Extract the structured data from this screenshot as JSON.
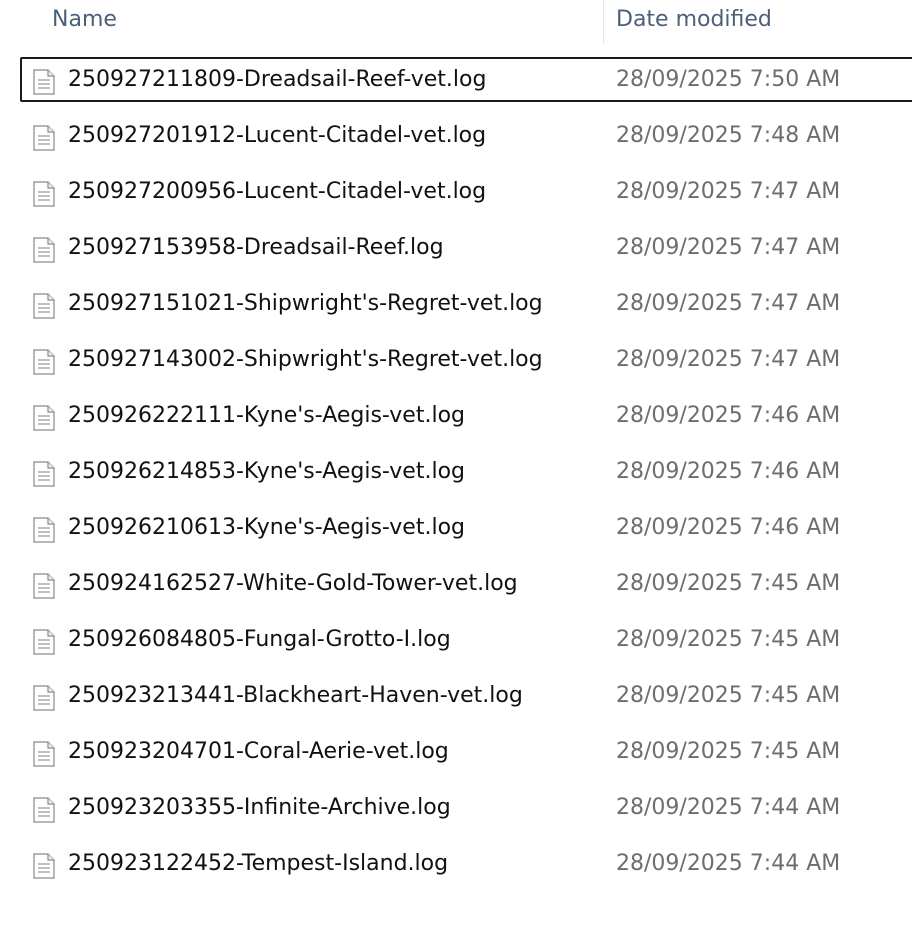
{
  "columns": {
    "name": "Name",
    "date_modified": "Date modified"
  },
  "icons": {
    "file": "text-file-icon",
    "sort": "sort-caret-icon"
  },
  "files": [
    {
      "name": "250927211809-Dreadsail-Reef-vet.log",
      "date": "28/09/2025 7:50 AM",
      "focused": true
    },
    {
      "name": "250927201912-Lucent-Citadel-vet.log",
      "date": "28/09/2025 7:48 AM"
    },
    {
      "name": "250927200956-Lucent-Citadel-vet.log",
      "date": "28/09/2025 7:47 AM"
    },
    {
      "name": "250927153958-Dreadsail-Reef.log",
      "date": "28/09/2025 7:47 AM"
    },
    {
      "name": "250927151021-Shipwright's-Regret-vet.log",
      "date": "28/09/2025 7:47 AM"
    },
    {
      "name": "250927143002-Shipwright's-Regret-vet.log",
      "date": "28/09/2025 7:47 AM"
    },
    {
      "name": "250926222111-Kyne's-Aegis-vet.log",
      "date": "28/09/2025 7:46 AM"
    },
    {
      "name": "250926214853-Kyne's-Aegis-vet.log",
      "date": "28/09/2025 7:46 AM"
    },
    {
      "name": "250926210613-Kyne's-Aegis-vet.log",
      "date": "28/09/2025 7:46 AM"
    },
    {
      "name": "250924162527-White-Gold-Tower-vet.log",
      "date": "28/09/2025 7:45 AM"
    },
    {
      "name": "250926084805-Fungal-Grotto-I.log",
      "date": "28/09/2025 7:45 AM"
    },
    {
      "name": "250923213441-Blackheart-Haven-vet.log",
      "date": "28/09/2025 7:45 AM"
    },
    {
      "name": "250923204701-Coral-Aerie-vet.log",
      "date": "28/09/2025 7:45 AM"
    },
    {
      "name": "250923203355-Infinite-Archive.log",
      "date": "28/09/2025 7:44 AM"
    },
    {
      "name": "250923122452-Tempest-Island.log",
      "date": "28/09/2025 7:44 AM"
    }
  ]
}
